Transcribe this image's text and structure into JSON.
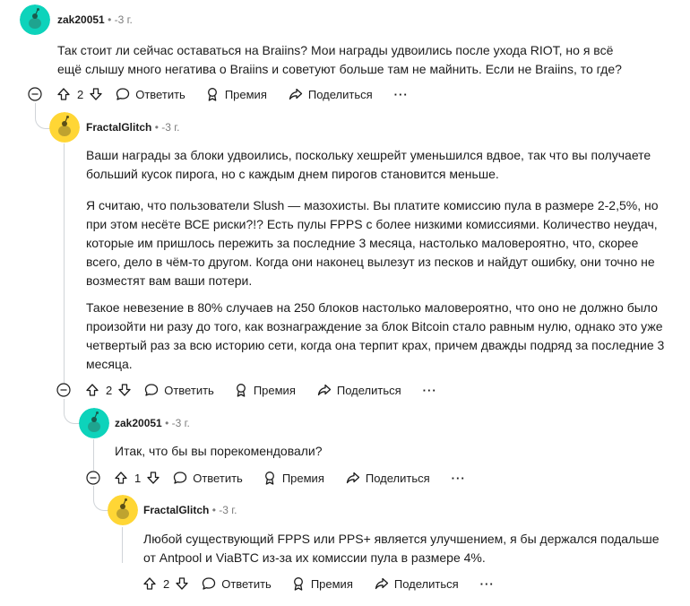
{
  "colors": {
    "avatar_teal": "#0dd3bb",
    "avatar_yellow": "#ffd635",
    "text": "#1c1c1c",
    "meta": "#7c7c7c",
    "thread_line": "#d0d4d8"
  },
  "actions": {
    "reply": "Ответить",
    "award": "Премия",
    "share": "Поделиться",
    "more": "···"
  },
  "comments": [
    {
      "author": "zak20051",
      "time": "-3 г.",
      "votes": "2",
      "avatar": "teal",
      "paragraphs": [
        "Так стоит ли сейчас оставаться на Braiins? Мои награды удвоились после ухода RIOT, но я всё ещё слышу много негатива о Braiins и советуют больше там не майнить. Если не Braiins, то где?"
      ]
    },
    {
      "author": "FractalGlitch",
      "time": "-3 г.",
      "votes": "2",
      "avatar": "yellow",
      "paragraphs": [
        "Ваши награды за блоки удвоились, поскольку хешрейт уменьшился вдвое, так что вы получаете больший кусок пирога, но с каждым днем пирогов становится меньше.",
        "Я считаю, что пользователи Slush — мазохисты. Вы платите комиссию пула в размере 2-2,5%, но при этом несёте ВСЕ риски?!? Есть пулы FPPS с более низкими комиссиями. Количество неудач, которые им пришлось пережить за последние 3 месяца, настолько маловероятно, что, скорее всего, дело в чём-то другом. Когда они наконец вылезут из песков и найдут ошибку, они точно не возместят вам ваши потери.",
        "Такое невезение в 80% случаев на 250 блоков настолько маловероятно, что оно не должно было произойти ни разу до того, как вознаграждение за блок Bitcoin стало равным нулю, однако это уже четвертый раз за всю историю сети, когда она терпит крах, причем дважды подряд за последние 3 месяца."
      ]
    },
    {
      "author": "zak20051",
      "time": "-3 г.",
      "votes": "1",
      "avatar": "teal",
      "paragraphs": [
        "Итак, что бы вы порекомендовали?"
      ]
    },
    {
      "author": "FractalGlitch",
      "time": "-3 г.",
      "votes": "2",
      "avatar": "yellow",
      "paragraphs": [
        "Любой существующий FPPS или PPS+ является улучшением, я бы держался подальше от Antpool и ViaBTC из-за их комиссии пула в размере 4%."
      ]
    }
  ]
}
